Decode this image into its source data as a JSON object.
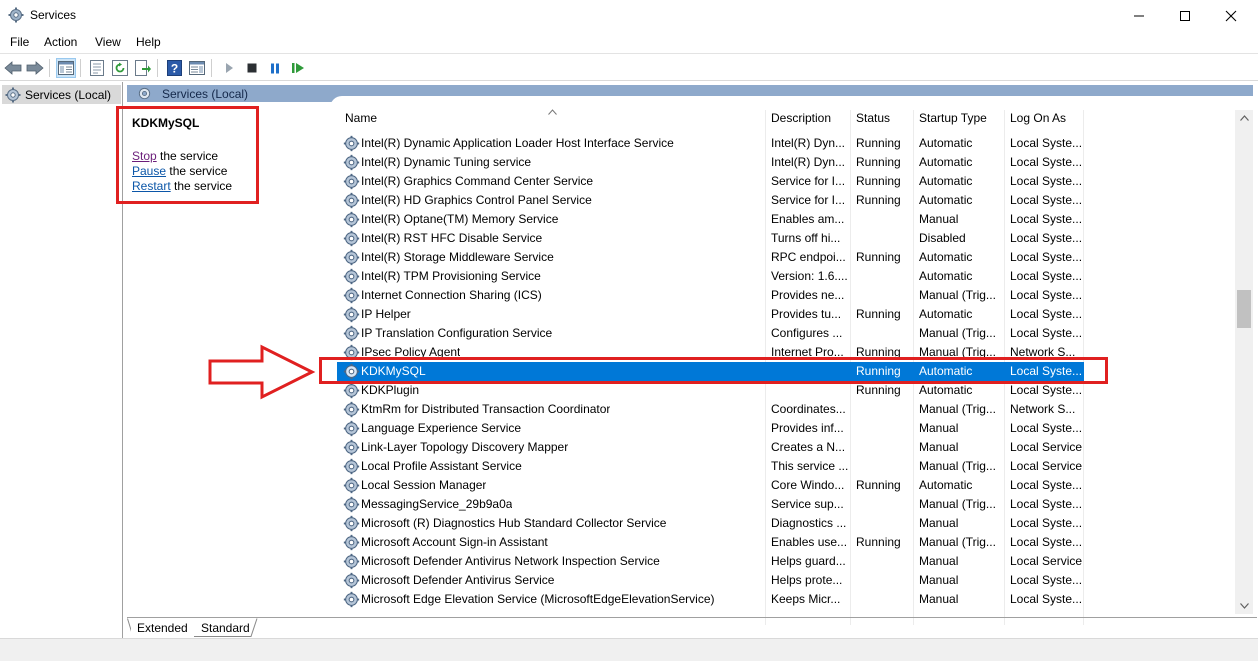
{
  "window": {
    "title": "Services"
  },
  "menu": [
    {
      "label": "File",
      "name": "menu-file"
    },
    {
      "label": "Action",
      "name": "menu-action"
    },
    {
      "label": "View",
      "name": "menu-view"
    },
    {
      "label": "Help",
      "name": "menu-help"
    }
  ],
  "toolbar": {
    "buttons": [
      "back-arrow-icon",
      "forward-arrow-icon",
      "show-hide-console-tree-icon",
      "properties-icon",
      "refresh-icon",
      "export-list-icon",
      "help-icon",
      "show-action-pane-icon",
      "start-service-icon",
      "stop-service-icon",
      "pause-service-icon",
      "restart-service-icon"
    ]
  },
  "tree": {
    "root_label": "Services (Local)"
  },
  "pane_header": {
    "label": "Services (Local)"
  },
  "extended": {
    "service_name": "KDKMySQL",
    "stop_link": "Stop",
    "stop_suffix": " the service",
    "pause_link": "Pause",
    "pause_suffix": " the service",
    "restart_link": "Restart",
    "restart_suffix": " the service"
  },
  "columns": {
    "name": "Name",
    "description": "Description",
    "status": "Status",
    "startup": "Startup Type",
    "logon": "Log On As"
  },
  "rows": [
    {
      "name": "Intel(R) Dynamic Application Loader Host Interface Service",
      "desc": "Intel(R) Dyn...",
      "status": "Running",
      "startup": "Automatic",
      "logon": "Local Syste..."
    },
    {
      "name": "Intel(R) Dynamic Tuning service",
      "desc": "Intel(R) Dyn...",
      "status": "Running",
      "startup": "Automatic",
      "logon": "Local Syste..."
    },
    {
      "name": "Intel(R) Graphics Command Center Service",
      "desc": "Service for I...",
      "status": "Running",
      "startup": "Automatic",
      "logon": "Local Syste..."
    },
    {
      "name": "Intel(R) HD Graphics Control Panel Service",
      "desc": "Service for I...",
      "status": "Running",
      "startup": "Automatic",
      "logon": "Local Syste..."
    },
    {
      "name": "Intel(R) Optane(TM) Memory Service",
      "desc": "Enables am...",
      "status": "",
      "startup": "Manual",
      "logon": "Local Syste..."
    },
    {
      "name": "Intel(R) RST HFC Disable Service",
      "desc": "Turns off hi...",
      "status": "",
      "startup": "Disabled",
      "logon": "Local Syste..."
    },
    {
      "name": "Intel(R) Storage Middleware Service",
      "desc": "RPC endpoi...",
      "status": "Running",
      "startup": "Automatic",
      "logon": "Local Syste..."
    },
    {
      "name": "Intel(R) TPM Provisioning Service",
      "desc": "Version: 1.6....",
      "status": "",
      "startup": "Automatic",
      "logon": "Local Syste..."
    },
    {
      "name": "Internet Connection Sharing (ICS)",
      "desc": "Provides ne...",
      "status": "",
      "startup": "Manual (Trig...",
      "logon": "Local Syste..."
    },
    {
      "name": "IP Helper",
      "desc": "Provides tu...",
      "status": "Running",
      "startup": "Automatic",
      "logon": "Local Syste..."
    },
    {
      "name": "IP Translation Configuration Service",
      "desc": "Configures ...",
      "status": "",
      "startup": "Manual (Trig...",
      "logon": "Local Syste..."
    },
    {
      "name": "IPsec Policy Agent",
      "desc": "Internet Pro...",
      "status": "Running",
      "startup": "Manual (Trig...",
      "logon": "Network S..."
    },
    {
      "name": "KDKMySQL",
      "desc": "",
      "status": "Running",
      "startup": "Automatic",
      "logon": "Local Syste...",
      "selected": true
    },
    {
      "name": "KDKPlugin",
      "desc": "",
      "status": "Running",
      "startup": "Automatic",
      "logon": "Local Syste..."
    },
    {
      "name": "KtmRm for Distributed Transaction Coordinator",
      "desc": "Coordinates...",
      "status": "",
      "startup": "Manual (Trig...",
      "logon": "Network S..."
    },
    {
      "name": "Language Experience Service",
      "desc": "Provides inf...",
      "status": "",
      "startup": "Manual",
      "logon": "Local Syste..."
    },
    {
      "name": "Link-Layer Topology Discovery Mapper",
      "desc": "Creates a N...",
      "status": "",
      "startup": "Manual",
      "logon": "Local Service"
    },
    {
      "name": "Local Profile Assistant Service",
      "desc": "This service ...",
      "status": "",
      "startup": "Manual (Trig...",
      "logon": "Local Service"
    },
    {
      "name": "Local Session Manager",
      "desc": "Core Windo...",
      "status": "Running",
      "startup": "Automatic",
      "logon": "Local Syste..."
    },
    {
      "name": "MessagingService_29b9a0a",
      "desc": "Service sup...",
      "status": "",
      "startup": "Manual (Trig...",
      "logon": "Local Syste..."
    },
    {
      "name": "Microsoft (R) Diagnostics Hub Standard Collector Service",
      "desc": "Diagnostics ...",
      "status": "",
      "startup": "Manual",
      "logon": "Local Syste..."
    },
    {
      "name": "Microsoft Account Sign-in Assistant",
      "desc": "Enables use...",
      "status": "Running",
      "startup": "Manual (Trig...",
      "logon": "Local Syste..."
    },
    {
      "name": "Microsoft Defender Antivirus Network Inspection Service",
      "desc": "Helps guard...",
      "status": "",
      "startup": "Manual",
      "logon": "Local Service"
    },
    {
      "name": "Microsoft Defender Antivirus Service",
      "desc": "Helps prote...",
      "status": "",
      "startup": "Manual",
      "logon": "Local Syste..."
    },
    {
      "name": "Microsoft Edge Elevation Service (MicrosoftEdgeElevationService)",
      "desc": "Keeps Micr...",
      "status": "",
      "startup": "Manual",
      "logon": "Local Syste..."
    }
  ],
  "tabs": [
    {
      "label": "Extended",
      "active": true
    },
    {
      "label": "Standard",
      "active": false
    }
  ],
  "colors": {
    "selection": "#0078d7",
    "highlight_red": "#e02020",
    "header_band": "#8ea9cb"
  }
}
